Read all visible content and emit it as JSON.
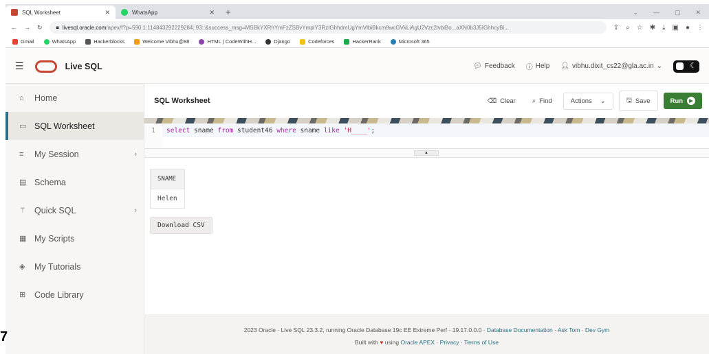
{
  "browser": {
    "tabs": [
      {
        "label": "SQL Worksheet",
        "active": true
      },
      {
        "label": "WhatsApp",
        "active": false
      }
    ],
    "new_tab": "+",
    "url_host": "livesql.oracle.com",
    "url_rest": "/apex/f?p=590:1:114843292229284::93::&success_msg=MSBkYXRhYmFzZSBvYmplY3RzIGhhdmUgYmVlbiBkcm9wcGVkLiAgU2Vzc2lvbiBo...aXN0b3J5IGhhcyBi...",
    "bookmarks": [
      "Gmail",
      "WhatsApp",
      "Hackerblocks",
      "Welcome Vibhu@88",
      "HTML | CodeWithH...",
      "Django",
      "Codeforces",
      "HackerRank",
      "Microsoft 365"
    ]
  },
  "header": {
    "app_name": "Live SQL",
    "feedback": "Feedback",
    "help": "Help",
    "user": "vibhu.dixit_cs22@gla.ac.in"
  },
  "sidebar": {
    "items": [
      {
        "label": "Home",
        "icon": "home-icon"
      },
      {
        "label": "SQL Worksheet",
        "icon": "worksheet-icon",
        "active": true
      },
      {
        "label": "My Session",
        "icon": "list-icon",
        "chevron": true
      },
      {
        "label": "Schema",
        "icon": "schema-icon"
      },
      {
        "label": "Quick SQL",
        "icon": "wand-icon",
        "chevron": true
      },
      {
        "label": "My Scripts",
        "icon": "script-icon"
      },
      {
        "label": "My Tutorials",
        "icon": "tutorial-icon"
      },
      {
        "label": "Code Library",
        "icon": "library-icon"
      }
    ]
  },
  "worksheet": {
    "title": "SQL Worksheet",
    "clear": "Clear",
    "find": "Find",
    "actions": "Actions",
    "save": "Save",
    "run": "Run",
    "line_number": "1",
    "code": {
      "kw1": "select",
      "t1": " sname ",
      "kw2": "from",
      "t2": " student46 ",
      "kw3": "where",
      "t3": " sname ",
      "kw4": "like",
      "t4": " ",
      "str": "'H____'",
      "t5": ";"
    }
  },
  "results": {
    "columns": [
      "SNAME"
    ],
    "rows": [
      [
        "Helen"
      ]
    ],
    "download": "Download CSV"
  },
  "footer": {
    "line1_text": "2023 Oracle · Live SQL 23.3.2, running Oracle Database 19c EE Extreme Perf - 19.17.0.0.0 · ",
    "doc_link": "Database Documentation",
    "sep1": " · ",
    "ask_tom": "Ask Tom",
    "sep2": " · ",
    "dev_gym": "Dev Gym",
    "built_with": "Built with",
    "using": "using",
    "apex": "Oracle APEX",
    "sep3": " · ",
    "privacy": "Privacy",
    "sep4": " · ",
    "terms": "Terms of Use"
  },
  "page_marker": "7",
  "colors": {
    "oracle_red": "#c74634",
    "run_green": "#3a7d34",
    "accent": "#2a6f82"
  }
}
